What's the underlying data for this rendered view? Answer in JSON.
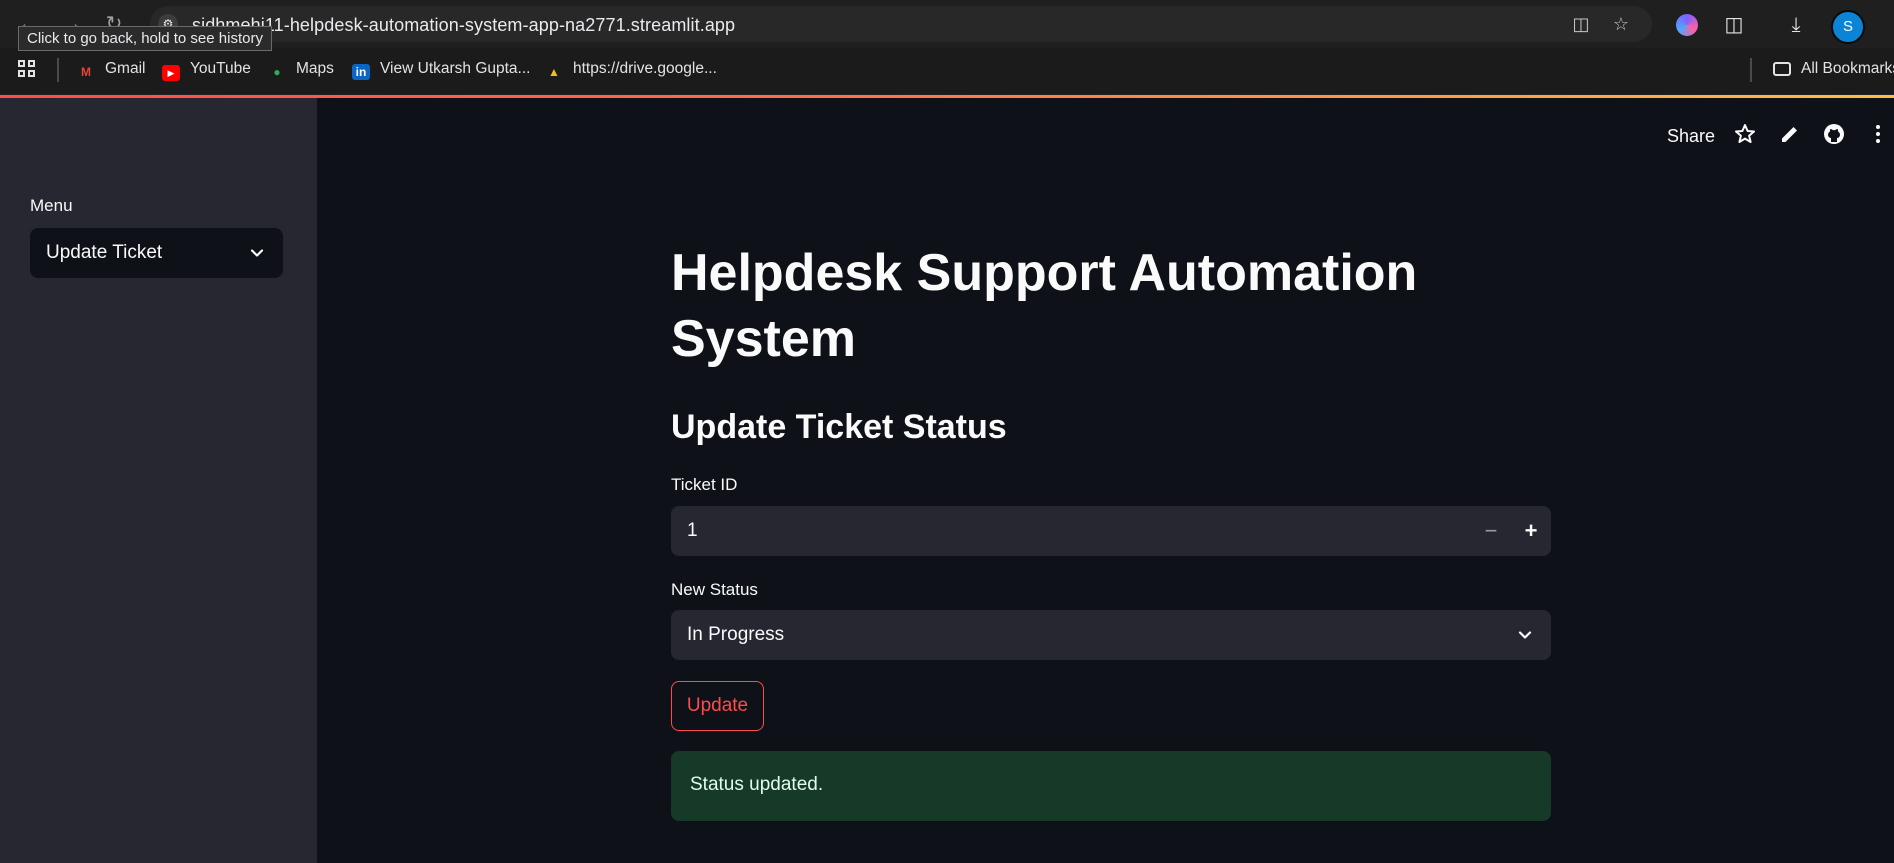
{
  "browser": {
    "url": "sidhmehi11-helpdesk-automation-system-app-na2771.streamlit.app",
    "tooltip": "Click to go back, hold to see history",
    "profile_initial": "S",
    "bookmarks": [
      {
        "label": "Gmail",
        "icon": "gmail-icon"
      },
      {
        "label": "YouTube",
        "icon": "youtube-icon"
      },
      {
        "label": "Maps",
        "icon": "maps-icon"
      },
      {
        "label": "View Utkarsh Gupta...",
        "icon": "linkedin-icon"
      },
      {
        "label": "https://drive.google...",
        "icon": "drive-icon"
      }
    ],
    "all_bookmarks_label": "All Bookmarks"
  },
  "sidebar": {
    "menu_label": "Menu",
    "menu_selected": "Update Ticket"
  },
  "header": {
    "share_label": "Share"
  },
  "main": {
    "title": "Helpdesk Support Automation System",
    "subtitle": "Update Ticket Status",
    "ticket_id_label": "Ticket ID",
    "ticket_id_value": "1",
    "new_status_label": "New Status",
    "new_status_value": "In Progress",
    "update_button": "Update",
    "success_message": "Status updated."
  },
  "colors": {
    "accent": "#ff4b4b",
    "background": "#0e1117",
    "sidebar": "#262730",
    "success_bg": "#173928"
  }
}
